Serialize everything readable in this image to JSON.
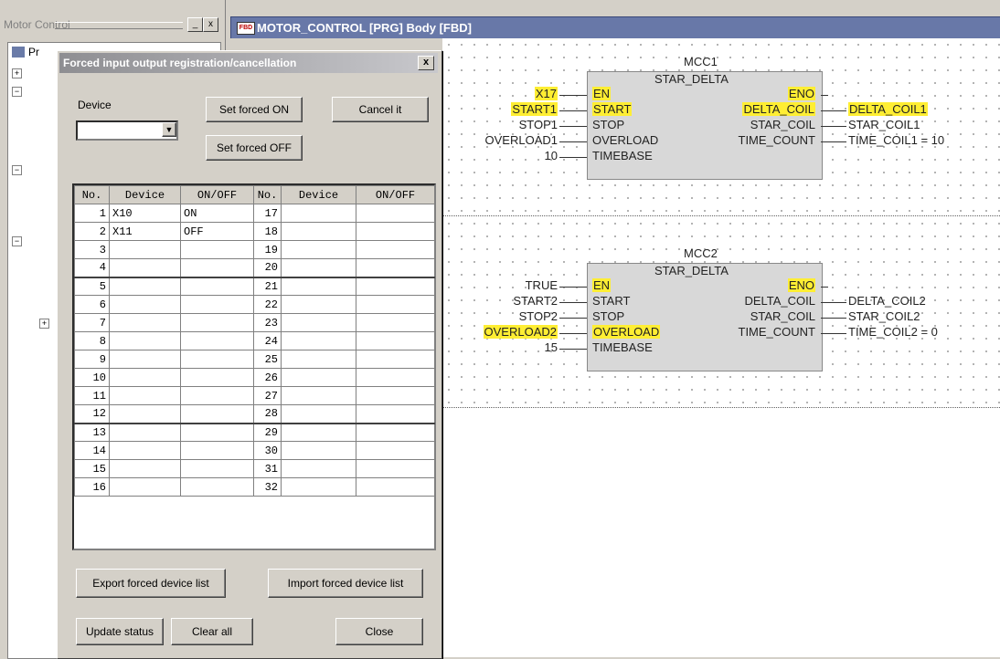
{
  "left_pane": {
    "title": "Motor Control",
    "pin_btn": "_",
    "close_btn": "x",
    "tree_label": "Pr"
  },
  "editor": {
    "icon_text": "FBD",
    "title": "MOTOR_CONTROL [PRG] Body [FBD]"
  },
  "fbd": {
    "blocks": [
      {
        "instance": "MCC1",
        "type": "STAR_DELTA",
        "inputs": [
          {
            "pin": "EN",
            "var": "X17",
            "pin_hl": true,
            "var_hl": true
          },
          {
            "pin": "START",
            "var": "START1",
            "pin_hl": true,
            "var_hl": true
          },
          {
            "pin": "STOP",
            "var": "STOP1",
            "pin_hl": false,
            "var_hl": false
          },
          {
            "pin": "OVERLOAD",
            "var": "OVERLOAD1",
            "pin_hl": false,
            "var_hl": false
          },
          {
            "pin": "TIMEBASE",
            "var": "10",
            "pin_hl": false,
            "var_hl": false
          }
        ],
        "outputs": [
          {
            "pin": "ENO",
            "var": "",
            "pin_hl": true,
            "var_hl": false
          },
          {
            "pin": "DELTA_COIL",
            "var": "DELTA_COIL1",
            "pin_hl": true,
            "var_hl": true
          },
          {
            "pin": "STAR_COIL",
            "var": "STAR_COIL1",
            "pin_hl": false,
            "var_hl": false
          },
          {
            "pin": "TIME_COUNT",
            "var": "TIME_COIL1 = 10",
            "pin_hl": false,
            "var_hl": false
          }
        ]
      },
      {
        "instance": "MCC2",
        "type": "STAR_DELTA",
        "inputs": [
          {
            "pin": "EN",
            "var": "TRUE",
            "pin_hl": true,
            "var_hl": false
          },
          {
            "pin": "START",
            "var": "START2",
            "pin_hl": false,
            "var_hl": false
          },
          {
            "pin": "STOP",
            "var": "STOP2",
            "pin_hl": false,
            "var_hl": false
          },
          {
            "pin": "OVERLOAD",
            "var": "OVERLOAD2",
            "pin_hl": true,
            "var_hl": true
          },
          {
            "pin": "TIMEBASE",
            "var": "15",
            "pin_hl": false,
            "var_hl": false
          }
        ],
        "outputs": [
          {
            "pin": "ENO",
            "var": "",
            "pin_hl": true,
            "var_hl": false
          },
          {
            "pin": "DELTA_COIL",
            "var": "DELTA_COIL2",
            "pin_hl": false,
            "var_hl": false
          },
          {
            "pin": "STAR_COIL",
            "var": "STAR_COIL2",
            "pin_hl": false,
            "var_hl": false
          },
          {
            "pin": "TIME_COUNT",
            "var": "TIME_COIL2 = 0",
            "pin_hl": false,
            "var_hl": false
          }
        ]
      }
    ]
  },
  "dialog": {
    "title": "Forced input output registration/cancellation",
    "close_btn": "x",
    "device_label": "Device",
    "device_value": "",
    "set_on_btn": "Set forced ON",
    "set_off_btn": "Set forced OFF",
    "cancel_btn": "Cancel it",
    "columns": [
      "No.",
      "Device",
      "ON/OFF",
      "No.",
      "Device",
      "ON/OFF"
    ],
    "rows_left": [
      {
        "no": "1",
        "device": "X10",
        "state": "ON"
      },
      {
        "no": "2",
        "device": "X11",
        "state": "OFF"
      },
      {
        "no": "3",
        "device": "",
        "state": ""
      },
      {
        "no": "4",
        "device": "",
        "state": ""
      },
      {
        "no": "5",
        "device": "",
        "state": ""
      },
      {
        "no": "6",
        "device": "",
        "state": ""
      },
      {
        "no": "7",
        "device": "",
        "state": ""
      },
      {
        "no": "8",
        "device": "",
        "state": ""
      },
      {
        "no": "9",
        "device": "",
        "state": ""
      },
      {
        "no": "10",
        "device": "",
        "state": ""
      },
      {
        "no": "11",
        "device": "",
        "state": ""
      },
      {
        "no": "12",
        "device": "",
        "state": ""
      },
      {
        "no": "13",
        "device": "",
        "state": ""
      },
      {
        "no": "14",
        "device": "",
        "state": ""
      },
      {
        "no": "15",
        "device": "",
        "state": ""
      },
      {
        "no": "16",
        "device": "",
        "state": ""
      }
    ],
    "rows_right": [
      {
        "no": "17",
        "device": "",
        "state": ""
      },
      {
        "no": "18",
        "device": "",
        "state": ""
      },
      {
        "no": "19",
        "device": "",
        "state": ""
      },
      {
        "no": "20",
        "device": "",
        "state": ""
      },
      {
        "no": "21",
        "device": "",
        "state": ""
      },
      {
        "no": "22",
        "device": "",
        "state": ""
      },
      {
        "no": "23",
        "device": "",
        "state": ""
      },
      {
        "no": "24",
        "device": "",
        "state": ""
      },
      {
        "no": "25",
        "device": "",
        "state": ""
      },
      {
        "no": "26",
        "device": "",
        "state": ""
      },
      {
        "no": "27",
        "device": "",
        "state": ""
      },
      {
        "no": "28",
        "device": "",
        "state": ""
      },
      {
        "no": "29",
        "device": "",
        "state": ""
      },
      {
        "no": "30",
        "device": "",
        "state": ""
      },
      {
        "no": "31",
        "device": "",
        "state": ""
      },
      {
        "no": "32",
        "device": "",
        "state": ""
      }
    ],
    "export_btn": "Export forced device list",
    "import_btn": "Import forced device list",
    "update_btn": "Update status",
    "clear_btn": "Clear all",
    "close_btn_label": "Close"
  },
  "colors": {
    "highlight": "#ffee33",
    "editor_title_bg": "#6878a8",
    "block_fill": "#d8d8d8"
  }
}
